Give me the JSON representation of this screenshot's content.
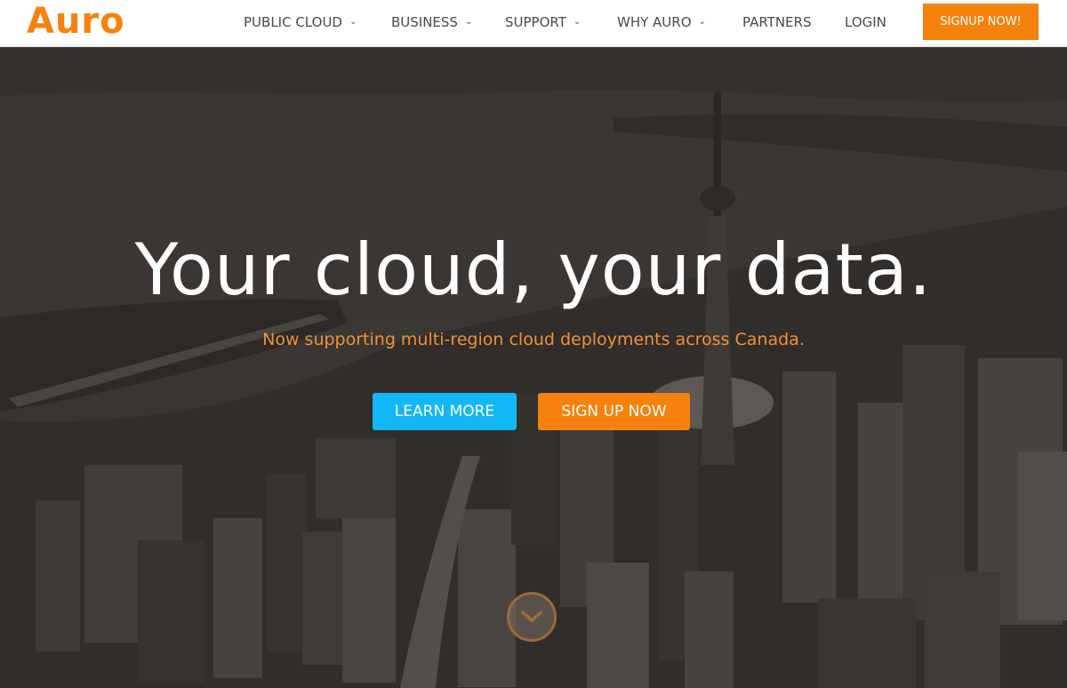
{
  "brand": {
    "logo_text": "Auro",
    "accent": "#f6820d"
  },
  "nav": {
    "items": [
      {
        "label": "PUBLIC CLOUD",
        "dropdown": true
      },
      {
        "label": "BUSINESS",
        "dropdown": true
      },
      {
        "label": "SUPPORT",
        "dropdown": true
      },
      {
        "label": "WHY AURO",
        "dropdown": true
      },
      {
        "label": "PARTNERS",
        "dropdown": false
      },
      {
        "label": "LOGIN",
        "dropdown": false
      }
    ],
    "signup_label": "SIGNUP NOW!"
  },
  "hero": {
    "title": "Your cloud, your data.",
    "subtitle": "Now supporting multi-region cloud deployments across Canada.",
    "learn_more_label": "LEARN MORE",
    "sign_up_label": "SIGN UP NOW",
    "scroll_icon": "chevron-down-icon"
  },
  "colors": {
    "learn_more_bg": "#14b7f5",
    "sign_up_bg": "#f6820d",
    "subtitle": "#f0913a",
    "hero_overlay": "#3f3b38"
  }
}
